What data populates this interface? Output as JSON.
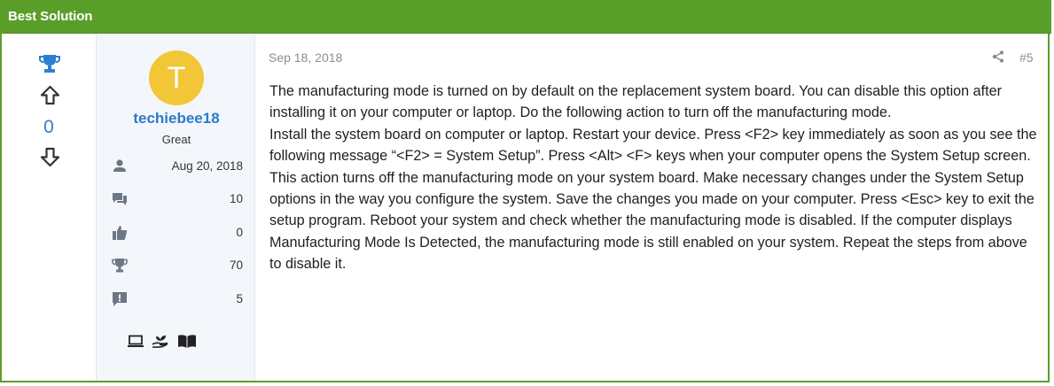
{
  "header": {
    "title": "Best Solution"
  },
  "votes": {
    "score": "0"
  },
  "user": {
    "avatar_letter": "T",
    "username": "techiebee18",
    "user_title": "Great",
    "stats": [
      {
        "icon": "user-icon",
        "value": "Aug 20, 2018"
      },
      {
        "icon": "messages-icon",
        "value": "10"
      },
      {
        "icon": "thumbs-up-icon",
        "value": "0"
      },
      {
        "icon": "trophy-icon",
        "value": "70"
      },
      {
        "icon": "report-icon",
        "value": "5"
      }
    ],
    "badges": [
      "laptop-icon",
      "hand-plant-icon",
      "book-icon"
    ]
  },
  "post": {
    "date": "Sep 18, 2018",
    "number": "#5",
    "paragraphs": [
      "The manufacturing mode is turned on by default on the replacement system board. You can disable this option after installing it on your computer or laptop. Do the following action to turn off the manufacturing mode.",
      "Install the system board on computer or laptop. Restart your device. Press <F2> key immediately as soon as you see the following message “<F2> = System Setup”. Press <Alt> <F> keys when your computer opens the System Setup screen. This action turns off the manufacturing mode on your system board. Make necessary changes under the System Setup options in the way you configure the system. Save the changes you made on your computer. Press <Esc> key to exit the setup program. Reboot your system and check whether the manufacturing mode is disabled. If the computer displays Manufacturing Mode Is Detected, the manufacturing mode is still enabled on your system. Repeat the steps from above to disable it."
    ]
  },
  "colors": {
    "header": "#5a9e2a",
    "accent": "#2e7fd1",
    "avatar": "#f2c637"
  }
}
